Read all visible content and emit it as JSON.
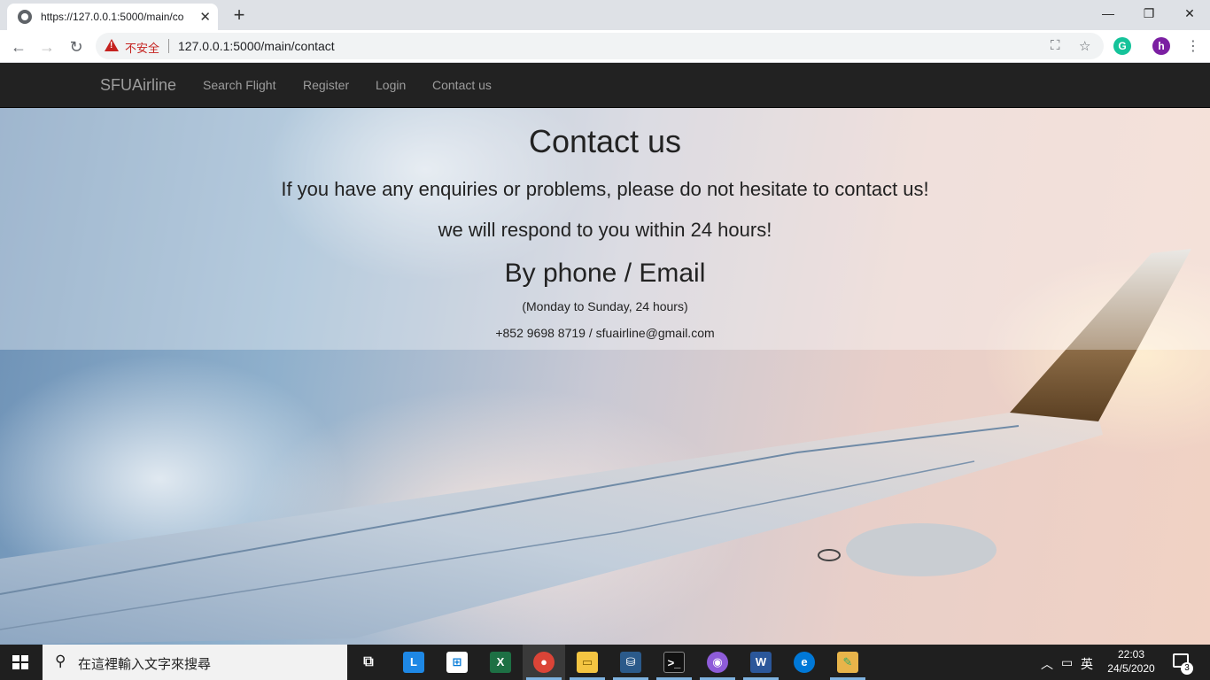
{
  "browser": {
    "tab_title": "https://127.0.0.1:5000/main/co",
    "new_tab_label": "+",
    "security_label": "不安全",
    "url": "127.0.0.1:5000/main/contact",
    "profile_initial": "h",
    "grammarly_initial": "G"
  },
  "navbar": {
    "brand": "SFUAirline",
    "links": [
      "Search Flight",
      "Register",
      "Login",
      "Contact us"
    ]
  },
  "content": {
    "title": "Contact us",
    "line1": "If you have any enquiries or problems, please do not hesitate to contact us!",
    "line2": "we will respond to you within 24 hours!",
    "subtitle": "By phone / Email",
    "hours": "(Monday to Sunday, 24 hours)",
    "contact": "+852 9698 8719 / sfuairline@gmail.com"
  },
  "taskbar": {
    "search_placeholder": "在這裡輸入文字來搜尋",
    "ime_label": "英",
    "time": "22:03",
    "date": "24/5/2020",
    "notification_count": "3",
    "apps": [
      "task-view",
      "lexicon",
      "store",
      "excel",
      "chrome",
      "file-explorer",
      "mysql-workbench",
      "terminal",
      "github-desktop",
      "word",
      "edge",
      "paint"
    ]
  },
  "colors": {
    "navbar_bg": "#222222",
    "nav_text": "#9d9d9d",
    "security_warning": "#c5221f",
    "taskbar_bg": "#1f1f1f"
  }
}
